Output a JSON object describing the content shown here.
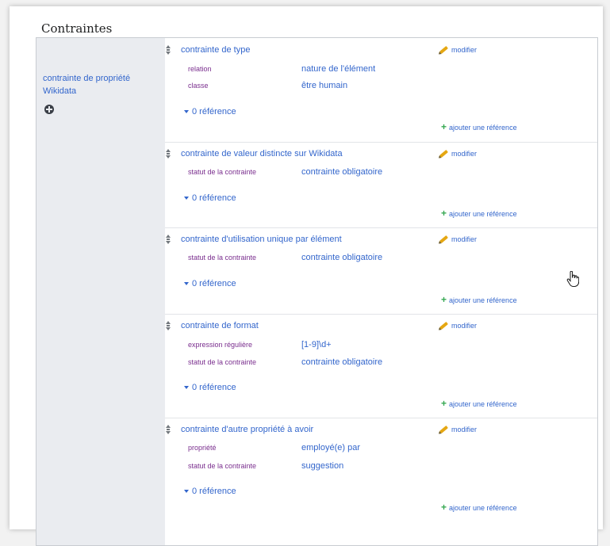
{
  "section": {
    "title": "Contraintes"
  },
  "group": {
    "property_label": "contrainte de propriété Wikidata"
  },
  "common": {
    "edit_label": "modifier",
    "refs_label": "0 référence",
    "add_ref_label": "ajouter une référence"
  },
  "statements": [
    {
      "value": "contrainte de type",
      "qualifiers": [
        {
          "property": "relation",
          "value": "nature de l'élément"
        },
        {
          "property": "classe",
          "value": "être humain"
        }
      ]
    },
    {
      "value": "contrainte de valeur distincte sur Wikidata",
      "qualifiers": [
        {
          "property": "statut de la contrainte",
          "value": "contrainte obligatoire"
        }
      ]
    },
    {
      "value": "contrainte d'utilisation unique par élément",
      "qualifiers": [
        {
          "property": "statut de la contrainte",
          "value": "contrainte obligatoire"
        }
      ]
    },
    {
      "value": "contrainte de format",
      "qualifiers": [
        {
          "property": "expression régulière",
          "value": "[1-9]\\d+"
        },
        {
          "property": "statut de la contrainte",
          "value": "contrainte obligatoire"
        }
      ]
    },
    {
      "value": "contrainte d'autre propriété à avoir",
      "qualifiers": [
        {
          "property": "propriété",
          "value": "employé(e) par"
        },
        {
          "property": "statut de la contrainte",
          "value": "suggestion"
        }
      ]
    }
  ],
  "colors": {
    "link": "#3366cc",
    "qualifier_property": "#7a2e8e",
    "edit_icon": "#e5a712",
    "add_icon": "#36a852",
    "left_panel_bg": "#eaecf0"
  }
}
